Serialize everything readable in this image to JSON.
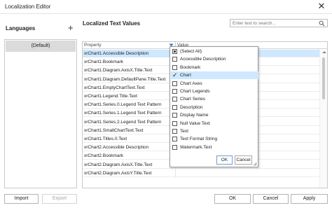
{
  "window": {
    "title": "Localization Editor"
  },
  "languages": {
    "header": "Languages",
    "add_symbol": "+",
    "items": [
      {
        "label": "(Default)"
      }
    ]
  },
  "values": {
    "header": "Localized Text Values",
    "search_placeholder": "Enter text to search..."
  },
  "grid": {
    "columns": [
      "Property",
      "Value"
    ],
    "rows": [
      "xrChart1.Accessible Description",
      "xrChart1.Bookmark",
      "xrChart1.Diagram.AxisX.Title.Text",
      "xrChart1.Diagram.DefaultPane.Title.Text",
      "xrChart1.EmptyChartText.Text",
      "xrChart1.Legend.Title.Text",
      "xrChart1.Series.0.Legend Text Pattern",
      "xrChart1.Series.1.Legend Text Pattern",
      "xrChart1.Series.2.Legend Text Pattern",
      "xrChart1.SmallChartText.Text",
      "xrChart1.Titles.0.Text",
      "xrChart2.Accessible Description",
      "xrChart2.Bookmark",
      "xrChart2.Diagram.AxisX.Title.Text",
      "xrChart2.Diagram.AxisY.Title.Text"
    ]
  },
  "filter_popup": {
    "options": [
      {
        "label": "(Select All)",
        "state": "indeterminate"
      },
      {
        "label": "Accessible Description",
        "state": "unchecked"
      },
      {
        "label": "Bookmark",
        "state": "unchecked"
      },
      {
        "label": "Chart",
        "state": "checked"
      },
      {
        "label": "Chart Axes",
        "state": "unchecked"
      },
      {
        "label": "Chart Legends",
        "state": "unchecked"
      },
      {
        "label": "Chart Series",
        "state": "unchecked"
      },
      {
        "label": "Description",
        "state": "unchecked"
      },
      {
        "label": "Display Name",
        "state": "unchecked"
      },
      {
        "label": "Null Value Text",
        "state": "unchecked"
      },
      {
        "label": "Text",
        "state": "unchecked"
      },
      {
        "label": "Text Format String",
        "state": "unchecked"
      },
      {
        "label": "Watermark.Text",
        "state": "unchecked"
      }
    ],
    "ok_label": "OK",
    "cancel_label": "Cancel"
  },
  "footer": {
    "import_label": "Import",
    "export_label": "Export",
    "ok_label": "OK",
    "cancel_label": "Cancel",
    "apply_label": "Apply"
  },
  "colors": {
    "selection": "#cde8ff",
    "accent": "#1e73c8"
  }
}
